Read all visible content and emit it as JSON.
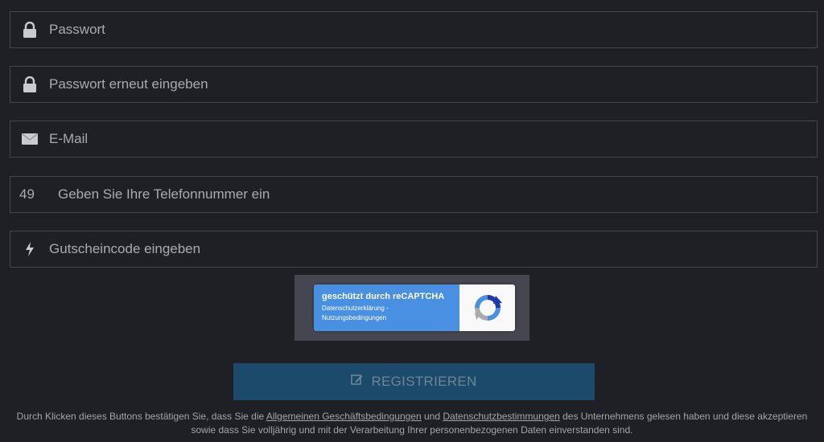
{
  "form": {
    "password": {
      "placeholder": "Passwort",
      "icon": "lock-icon"
    },
    "password_repeat": {
      "placeholder": "Passwort erneut eingeben",
      "icon": "lock-icon"
    },
    "email": {
      "placeholder": "E-Mail",
      "icon": "envelope-icon"
    },
    "phone": {
      "prefix": "49",
      "placeholder": "Geben Sie Ihre Telefonnummer ein"
    },
    "voucher": {
      "placeholder": "Gutscheincode eingeben",
      "icon": "lightning-icon"
    }
  },
  "recaptcha": {
    "title": "geschützt durch reCAPTCHA",
    "privacy_link": "Datenschutzerklärung",
    "separator": " - ",
    "terms_link": "Nutzungsbedingungen"
  },
  "register_button": {
    "label": "REGISTRIEREN",
    "icon": "edit-icon"
  },
  "legal": {
    "text_1": "Durch Klicken dieses Buttons bestätigen Sie, dass Sie die ",
    "link_agb": "Allgemeinen Geschäftsbedingungen",
    "text_2": " und ",
    "link_privacy": "Datenschutzbestimmungen",
    "text_3": " des Unternehmens gelesen haben und diese akzeptieren sowie dass Sie volljährig und mit der Verarbeitung Ihrer personenbezogenen Daten einverstanden sind."
  },
  "colors": {
    "background": "#1f2026",
    "field_border": "#3e4a4c",
    "button_bg": "#1b4a6b",
    "recaptcha_blue": "#4a90e2"
  }
}
